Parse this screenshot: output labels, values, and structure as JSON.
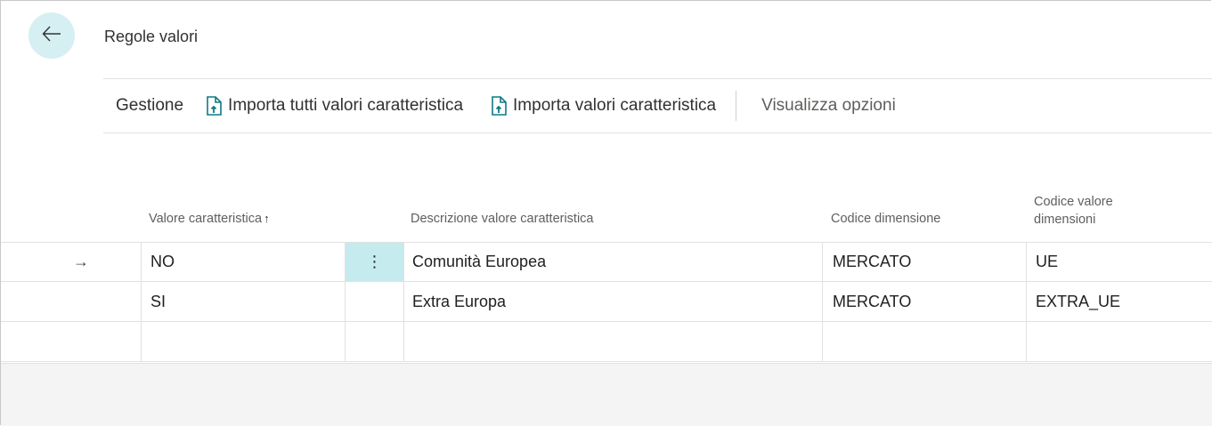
{
  "page": {
    "title": "Regole valori"
  },
  "actions": {
    "gestione": "Gestione",
    "import_all": "Importa tutti valori caratteristica",
    "import": "Importa valori caratteristica",
    "view_options": "Visualizza opzioni"
  },
  "columns": {
    "valore": "Valore caratteristica",
    "sort_indicator": "↑",
    "descrizione": "Descrizione valore caratteristica",
    "codice_dimensione": "Codice dimensione",
    "codice_valore": "Codice valore dimensioni"
  },
  "rows": [
    {
      "indicator": "→",
      "valore": "NO",
      "menu": "⋮",
      "descrizione": "Comunità Europea",
      "codice_dimensione": "MERCATO",
      "codice_valore": "UE"
    },
    {
      "indicator": "",
      "valore": "SI",
      "menu": "",
      "descrizione": "Extra Europa",
      "codice_dimensione": "MERCATO",
      "codice_valore": "EXTRA_UE"
    },
    {
      "indicator": "",
      "valore": "",
      "menu": "",
      "descrizione": "",
      "codice_dimensione": "",
      "codice_valore": ""
    }
  ],
  "icons": {
    "back": "arrow-left-icon",
    "import_doc": "document-import-icon"
  },
  "colors": {
    "accent": "#0e7a86",
    "back_button_bg": "#d5eff2",
    "selected_cell_bg": "#c5ebef"
  }
}
